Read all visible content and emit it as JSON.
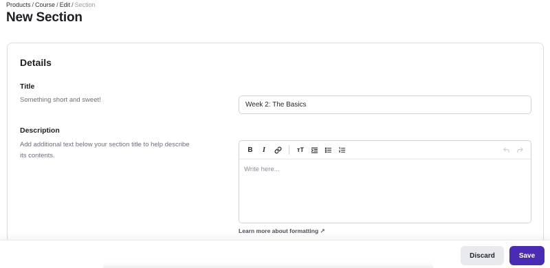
{
  "breadcrumb": {
    "items": [
      "Products",
      "Course",
      "Edit"
    ],
    "current": "Section",
    "separator": "/"
  },
  "page": {
    "title": "New Section"
  },
  "card": {
    "heading": "Details",
    "title_field": {
      "label": "Title",
      "help": "Something short and sweet!",
      "value": "Week 2: The Basics"
    },
    "description_field": {
      "label": "Description",
      "help": "Add additional text below your section title to help describe its contents.",
      "placeholder": "Write here...",
      "value": ""
    },
    "toolbar": {
      "bold": "B",
      "italic": "I",
      "text_size": "ᴛT",
      "icons": [
        "bold-icon",
        "italic-icon",
        "link-icon",
        "text-size-icon",
        "indent-icon",
        "bullet-list-icon",
        "numbered-list-icon",
        "undo-icon",
        "redo-icon"
      ]
    },
    "formatting_link": {
      "label": "Learn more about formatting",
      "arrow": "↗"
    }
  },
  "footer": {
    "discard_label": "Discard",
    "save_label": "Save"
  },
  "colors": {
    "primary": "#4a2bb3",
    "secondary_button": "#e9eaed",
    "border": "#d9dce1"
  }
}
